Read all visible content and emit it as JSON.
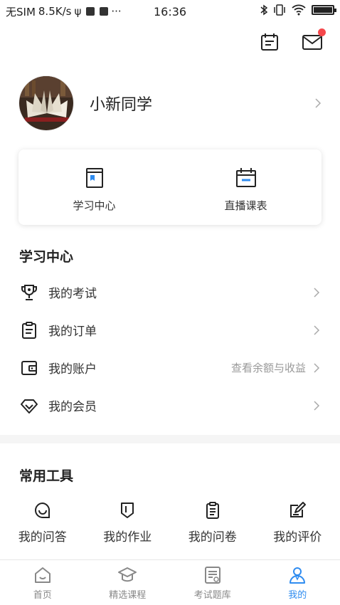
{
  "status_bar": {
    "carrier": "无SIM",
    "speed": "8.5K/s",
    "extra": "···",
    "time": "16:36"
  },
  "profile": {
    "name": "小新同学"
  },
  "card": {
    "items": [
      {
        "label": "学习中心",
        "icon": "bookmark-book-icon"
      },
      {
        "label": "直播课表",
        "icon": "calendar-icon"
      }
    ]
  },
  "study_section": {
    "title": "学习中心",
    "items": [
      {
        "label": "我的考试",
        "icon": "trophy-icon",
        "hint": ""
      },
      {
        "label": "我的订单",
        "icon": "clipboard-icon",
        "hint": ""
      },
      {
        "label": "我的账户",
        "icon": "wallet-icon",
        "hint": "查看余额与收益"
      },
      {
        "label": "我的会员",
        "icon": "diamond-icon",
        "hint": ""
      }
    ]
  },
  "tools_section": {
    "title": "常用工具",
    "items": [
      {
        "label": "我的问答",
        "icon": "chat-smile-icon"
      },
      {
        "label": "我的作业",
        "icon": "shield-bookmark-icon"
      },
      {
        "label": "我的问卷",
        "icon": "clipboard-list-icon"
      },
      {
        "label": "我的评价",
        "icon": "edit-icon"
      }
    ]
  },
  "tabbar": {
    "tabs": [
      {
        "label": "首页",
        "icon": "home-icon",
        "active": false
      },
      {
        "label": "精选课程",
        "icon": "graduation-cap-icon",
        "active": false
      },
      {
        "label": "考试题库",
        "icon": "exam-doc-icon",
        "active": false
      },
      {
        "label": "我的",
        "icon": "user-icon",
        "active": true
      }
    ]
  },
  "colors": {
    "accent": "#2f8cf0",
    "badge": "#f5474b",
    "text": "#333333",
    "hint": "#999999"
  }
}
